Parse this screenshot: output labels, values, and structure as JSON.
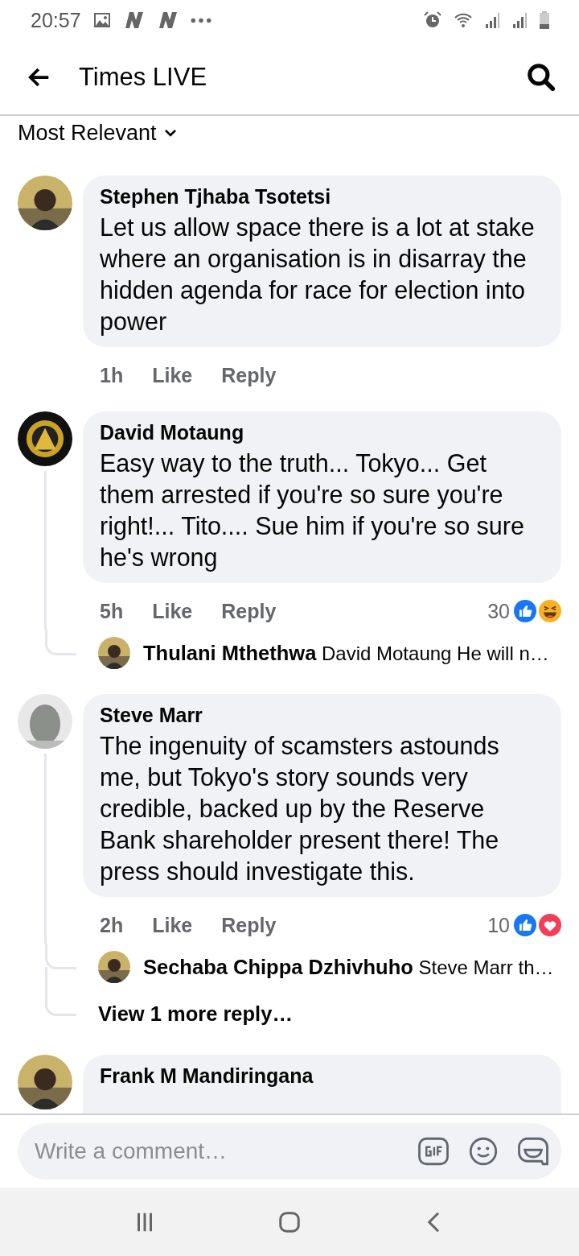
{
  "status_bar": {
    "time": "20:57"
  },
  "header": {
    "title": "Times LIVE"
  },
  "sort": {
    "label": "Most Relevant"
  },
  "comments": [
    {
      "author": "Stephen Tjhaba Tsotetsi",
      "text": "Let us allow space there is a lot at stake where an organisation is in disarray the hidden agenda for race for election into power",
      "time": "1h",
      "actions": [
        "Like",
        "Reply"
      ]
    },
    {
      "author": "David Motaung",
      "text": "Easy way to the truth... Tokyo... Get them arrested if you're so sure you're right!... Tito.... Sue him if you're so sure he's wrong",
      "time": "5h",
      "actions": [
        "Like",
        "Reply"
      ],
      "reaction_count": "30",
      "reactions": [
        {
          "kind": "like"
        },
        {
          "kind": "haha"
        }
      ],
      "replies": [
        {
          "author": "Thulani Mthethwa",
          "text": "David Motaung He will n…"
        }
      ]
    },
    {
      "author": "Steve Marr",
      "text": "The ingenuity of scamsters astounds me, but Tokyo's story sounds very credible, backed up by the Reserve Bank shareholder present there! The press should investigate this.",
      "time": "2h",
      "actions": [
        "Like",
        "Reply"
      ],
      "reaction_count": "10",
      "reactions": [
        {
          "kind": "like"
        },
        {
          "kind": "love"
        }
      ],
      "replies": [
        {
          "author": "Sechaba Chippa Dzhivhuho",
          "text": "Steve Marr th…"
        }
      ],
      "more_replies": "View 1 more reply…"
    },
    {
      "author": "Frank M Mandiringana"
    }
  ],
  "composer": {
    "placeholder": "Write a comment…"
  }
}
